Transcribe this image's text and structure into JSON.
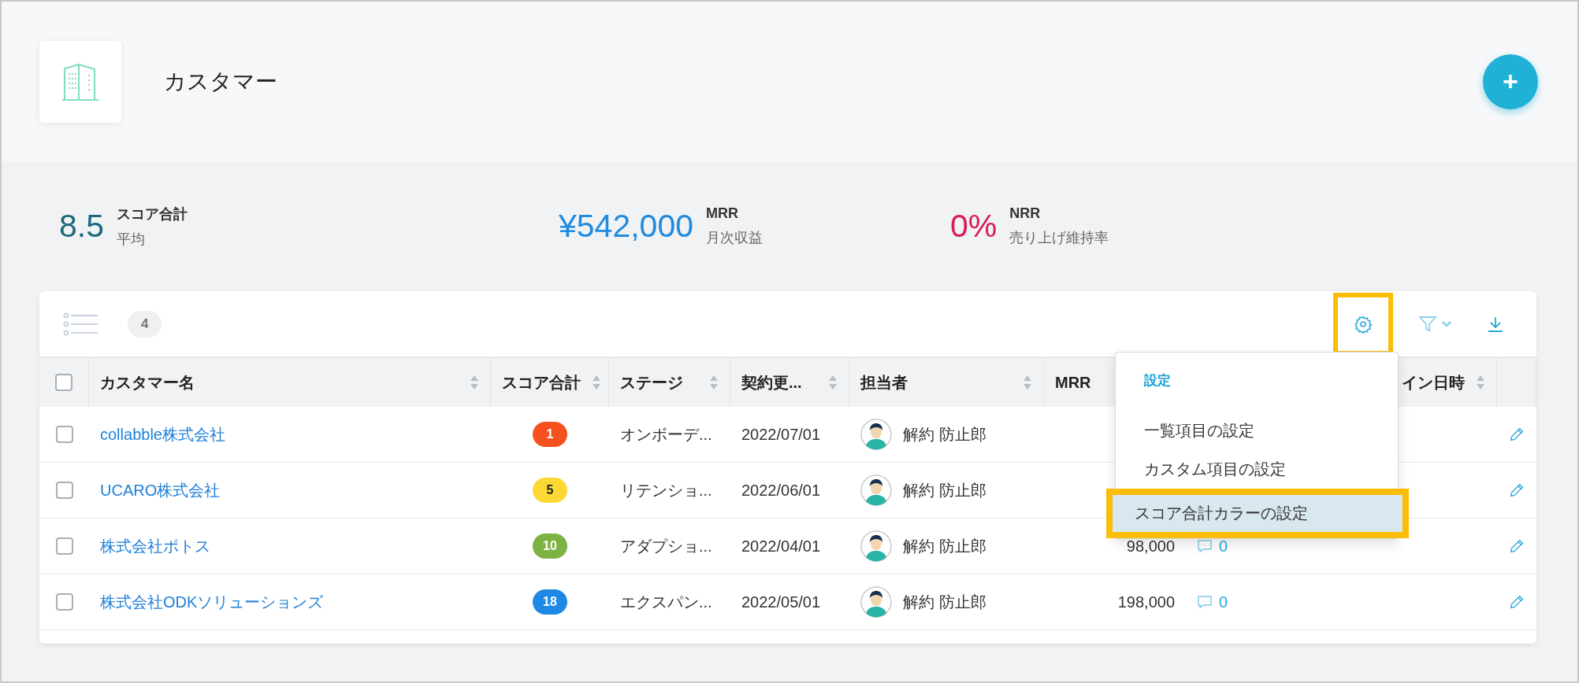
{
  "header": {
    "title": "カスタマー",
    "add_button": "+"
  },
  "stats": [
    {
      "value": "8.5",
      "metric": "スコア合計",
      "description": "平均",
      "color": "#1a6a7c"
    },
    {
      "value": "¥542,000",
      "metric": "MRR",
      "description": "月次収益",
      "color": "#1f8be0"
    },
    {
      "value": "0%",
      "metric": "NRR",
      "description": "売り上げ維持率",
      "color": "#d81b5a"
    }
  ],
  "toolbar": {
    "count": "4",
    "settings_highlighted": true
  },
  "table": {
    "all_checked": false,
    "columns": [
      {
        "label": "カスタマー名",
        "sortable": true
      },
      {
        "label": "スコア合計",
        "sortable": true
      },
      {
        "label": "ステージ",
        "sortable": true
      },
      {
        "label": "契約更...",
        "sortable": true
      },
      {
        "label": "担当者",
        "sortable": true
      },
      {
        "label": "MRR",
        "sortable": false
      },
      {
        "sortable": false
      },
      {
        "label": "イン日時",
        "sortable": true
      }
    ],
    "rows": [
      {
        "checked": false,
        "name": "collabble株式会社",
        "score": "1",
        "color": "#f4511e",
        "stage": "オンボーデ...",
        "contract": "2022/07/01",
        "owner": "解約 防止郎"
      },
      {
        "checked": false,
        "name": "UCARO株式会社",
        "score": "5",
        "color": "#fdd835",
        "stage": "リテンショ...",
        "contract": "2022/06/01",
        "owner": "解約 防止郎"
      },
      {
        "checked": false,
        "name": "株式会社ポトス",
        "score": "10",
        "color": "#7cb342",
        "stage": "アダプショ...",
        "contract": "2022/04/01",
        "owner": "解約 防止郎",
        "mrr": "98,000",
        "comments": "0"
      },
      {
        "checked": false,
        "name": "株式会社ODKソリューションズ",
        "score": "18",
        "color": "#1e88e5",
        "stage": "エクスパン...",
        "contract": "2022/05/01",
        "owner": "解約 防止郎",
        "mrr": "198,000",
        "comments": "0"
      }
    ]
  },
  "menu": {
    "title": "設定",
    "items": [
      {
        "label": "一覧項目の設定",
        "selected": false,
        "highlighted": false
      },
      {
        "label": "カスタム項目の設定",
        "selected": false,
        "highlighted": false
      },
      {
        "label": "スコア合計カラーの設定",
        "selected": true,
        "highlighted": true
      }
    ]
  }
}
